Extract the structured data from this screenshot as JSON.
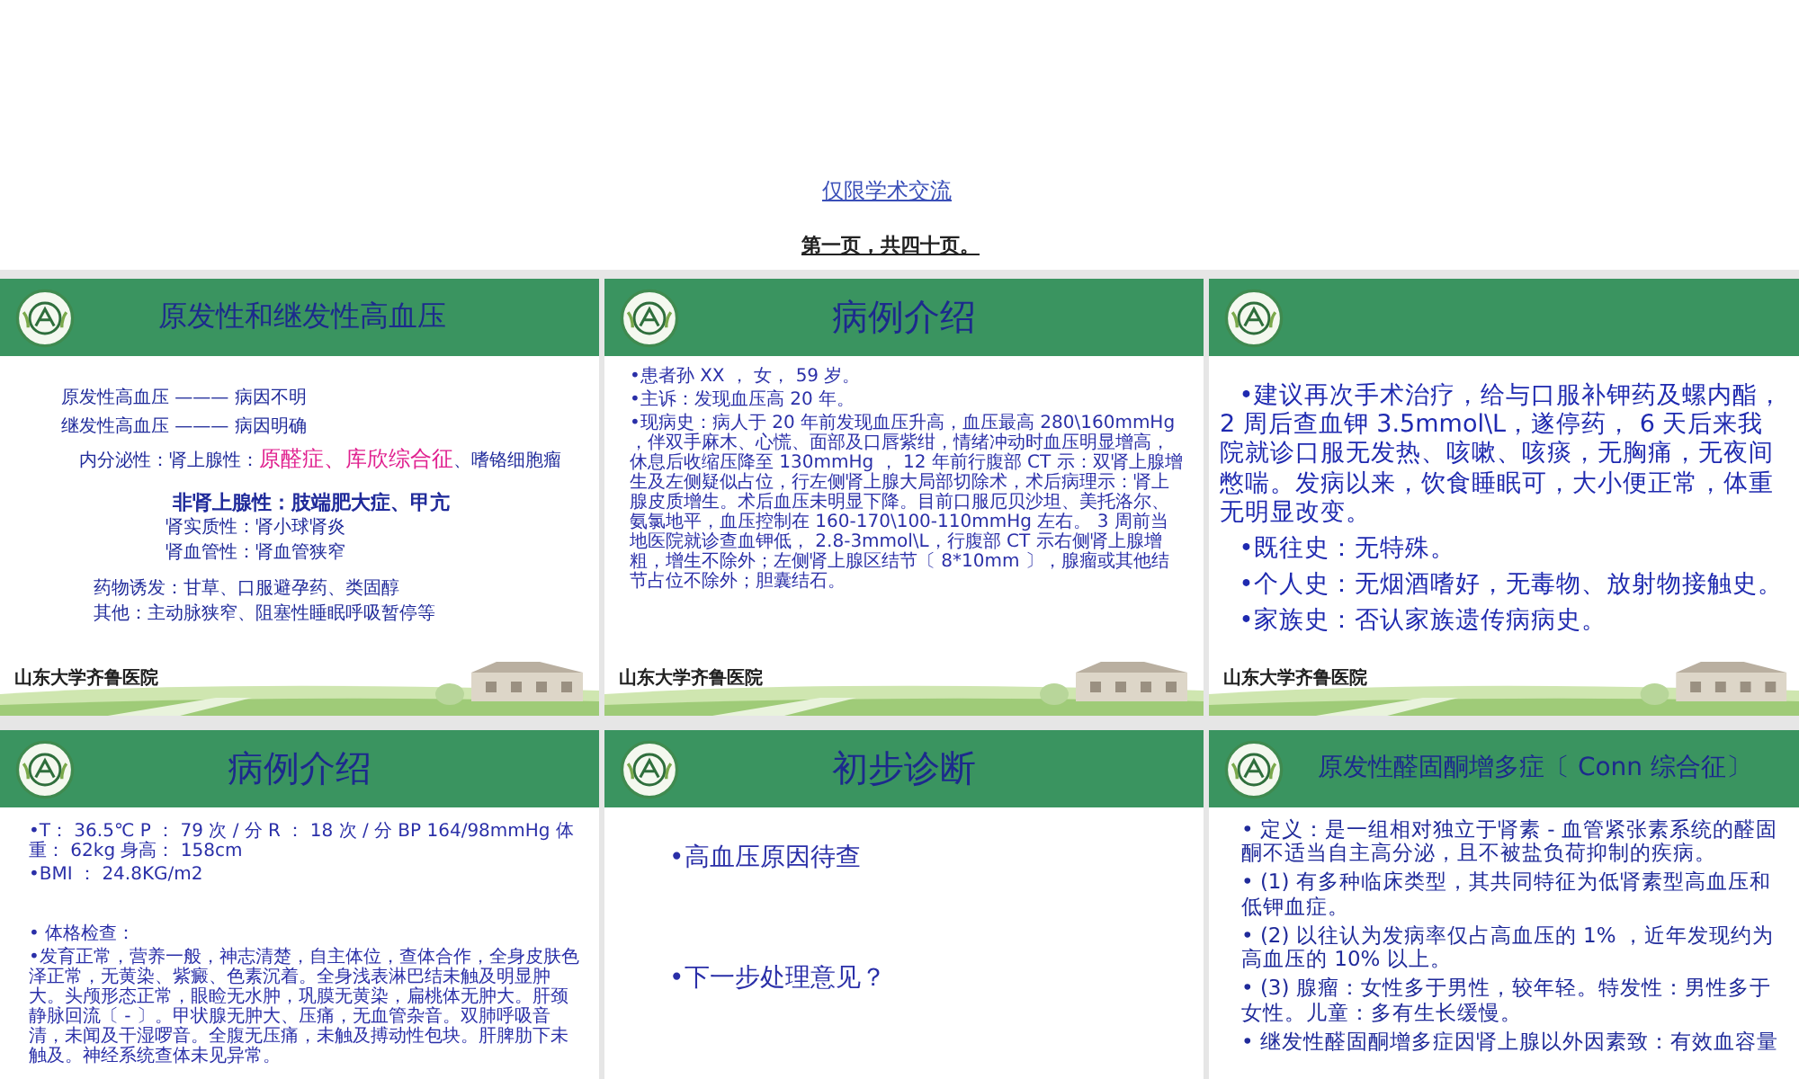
{
  "header": {
    "link": "仅限学术交流",
    "page_info": "第一页，共四十页。"
  },
  "slides": [
    {
      "kind": "serif",
      "title": "原发性和继发性高血压",
      "footer_logo": "山东大学齐鲁医院",
      "body": [
        {
          "kind": "definition",
          "parts": [
            {
              "kind": "plain",
              "text": "原发性高血压 ——— 病因不明"
            }
          ]
        },
        {
          "kind": "definition",
          "parts": [
            {
              "kind": "plain",
              "text": "继发性高血压 ——— 病因明确"
            }
          ]
        },
        {
          "kind": "category",
          "parts": [
            {
              "kind": "plain",
              "text": "内分泌性：肾上腺性："
            },
            {
              "kind": "highlight",
              "text": "原醛症、库欣综合征"
            },
            {
              "kind": "note",
              "text": "、嗜铬细胞瘤"
            }
          ]
        },
        {
          "kind": "heading",
          "parts": [
            {
              "kind": "plain",
              "text": "非肾上腺性：肢端肥大症、甲亢"
            }
          ]
        },
        {
          "kind": "subcategory",
          "parts": [
            {
              "kind": "plain",
              "text": "肾实质性：肾小球肾炎"
            }
          ]
        },
        {
          "kind": "subcategory",
          "parts": [
            {
              "kind": "plain",
              "text": "肾血管性：肾血管狭窄"
            }
          ]
        },
        {
          "kind": "cause",
          "parts": [
            {
              "kind": "plain",
              "text": "药物诱发：甘草、口服避孕药、类固醇"
            }
          ]
        },
        {
          "kind": "cause",
          "parts": [
            {
              "kind": "plain",
              "text": "其他：主动脉狭窄、阻塞性睡眠呼吸暂停等"
            }
          ]
        }
      ]
    },
    {
      "kind": "sans",
      "title": "病例介绍",
      "footer_logo": "山东大学齐鲁医院",
      "body": [
        {
          "kind": "small",
          "parts": [
            {
              "kind": "plain",
              "text": "•患者孙 XX ， 女， 59 岁。"
            }
          ]
        },
        {
          "kind": "small",
          "parts": [
            {
              "kind": "plain",
              "text": "•主诉：发现血压高 20 年。"
            }
          ]
        },
        {
          "kind": "small",
          "parts": [
            {
              "kind": "plain",
              "text": "•现病史：病人于 20 年前发现血压升高，血压最高 280\\160mmHg ，伴双手麻木、心慌、面部及口唇紫绀，情绪冲动时血压明显增高，休息后收缩压降至 130mmHg ， 12 年前行腹部 CT 示：双肾上腺增生及左侧疑似占位，行左侧肾上腺大局部切除术，术后病理示：肾上腺皮质增生。术后血压未明显下降。目前口服厄贝沙坦、美托洛尔、氨氯地平，血压控制在 160-170\\100-110mmHg 左右。 3 周前当地医院就诊查血钾低， 2.8-3mmol\\L，行腹部 CT 示右侧肾上腺增粗，增生不除外；左侧肾上腺区结节〔 8*10mm 〕，腺瘤或其他结节占位不除外；胆囊结石。"
            }
          ]
        }
      ]
    },
    {
      "kind": "sans",
      "footer_logo": "山东大学齐鲁医院",
      "body": [
        {
          "kind": "large",
          "parts": [
            {
              "kind": "plain",
              "text": "•建议再次手术治疗，给与口服补钾药及螺内酯， 2 周后查血钾 3.5mmol\\L，遂停药， 6 天后来我院就诊口服无发热、咳嗽、咳痰，无胸痛，无夜间憋喘。发病以来，饮食睡眠可，大小便正常，体重无明显改变。"
            }
          ]
        },
        {
          "kind": "large",
          "parts": [
            {
              "kind": "plain",
              "text": "•既往史：无特殊。"
            }
          ]
        },
        {
          "kind": "large",
          "parts": [
            {
              "kind": "plain",
              "text": "•个人史：无烟酒嗜好，无毒物、放射物接触史。"
            }
          ]
        },
        {
          "kind": "large",
          "parts": [
            {
              "kind": "plain",
              "text": "•家族史：否认家族遗传病病史。"
            }
          ]
        }
      ]
    },
    {
      "kind": "sans",
      "title": "病例介绍",
      "body": [
        {
          "kind": "small",
          "parts": [
            {
              "kind": "plain",
              "text": "•T： 36.5℃ P ： 79 次 / 分 R ： 18 次 / 分 BP 164/98mmHg 体重： 62kg 身高： 158cm"
            }
          ]
        },
        {
          "kind": "small",
          "parts": [
            {
              "kind": "plain",
              "text": "•BMI ： 24.8KG/m2"
            }
          ]
        },
        {
          "kind": "gap",
          "parts": [
            {
              "kind": "plain",
              "text": "• 体格检查："
            }
          ]
        },
        {
          "kind": "small",
          "parts": [
            {
              "kind": "plain",
              "text": "•发育正常，营养一般，神志清楚，自主体位，查体合作，全身皮肤色泽正常，无黄染、紫癜、色素沉着。全身浅表淋巴结未触及明显肿大。头颅形态正常，眼睑无水肿，巩膜无黄染，扁桃体无肿大。肝颈静脉回流〔 - 〕。甲状腺无肿大、压痛，无血管杂音。双肺呼吸音清，未闻及干湿啰音。全腹无压痛，未触及搏动性包块。肝脾肋下未触及。神经系统查体未见异常。"
            }
          ]
        }
      ]
    },
    {
      "kind": "sans",
      "title": "初步诊断",
      "body": [
        {
          "kind": "spaced",
          "parts": [
            {
              "kind": "plain",
              "text": "•高血压原因待查"
            }
          ]
        },
        {
          "kind": "spaced",
          "parts": [
            {
              "kind": "plain",
              "text": "•下一步处理意见？"
            }
          ]
        }
      ]
    },
    {
      "kind": "sans",
      "title": "原发性醛固酮增多症〔 Conn 综合征〕",
      "body": [
        {
          "kind": "medium",
          "parts": [
            {
              "kind": "plain",
              "text": "•  定义：是一组相对独立于肾素 - 血管紧张素系统的醛固酮不适当自主高分泌，且不被盐负荷抑制的疾病。"
            }
          ]
        },
        {
          "kind": "medium",
          "parts": [
            {
              "kind": "plain",
              "text": "• (1) 有多种临床类型，其共同特征为低肾素型高血压和低钾血症。"
            }
          ]
        },
        {
          "kind": "medium",
          "parts": [
            {
              "kind": "plain",
              "text": "• (2) 以往认为发病率仅占高血压的 1% ，近年发现约为高血压的 10% 以上。"
            }
          ]
        },
        {
          "kind": "medium",
          "parts": [
            {
              "kind": "plain",
              "text": "• (3) 腺瘤：女性多于男性，较年轻。特发性：男性多于女性。儿童：多有生长缓慢。"
            }
          ]
        },
        {
          "kind": "medium",
          "parts": [
            {
              "kind": "plain",
              "text": "• 继发性醛固酮增多症因肾上腺以外因素致：有效血容量"
            }
          ]
        }
      ]
    }
  ]
}
